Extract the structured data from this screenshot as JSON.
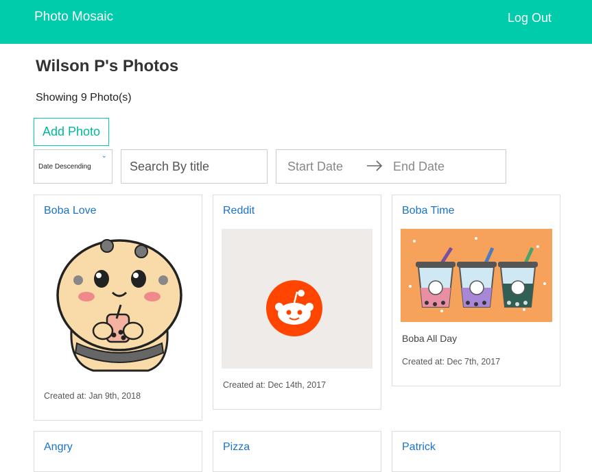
{
  "app": {
    "brand": "Photo Mosaic",
    "logout_label": "Log Out"
  },
  "page": {
    "title": "Wilson P's Photos",
    "count_text": "Showing 9 Photo(s)"
  },
  "toolbar": {
    "add_label": "Add Photo",
    "sort_value": "Date Descending",
    "search_placeholder": "Search By title",
    "start_date_placeholder": "Start Date",
    "end_date_placeholder": "End Date"
  },
  "photos": [
    {
      "title": "Boba Love",
      "description": "",
      "created": "Created at: Jan 9th, 2018"
    },
    {
      "title": "Reddit",
      "description": "",
      "created": "Created at: Dec 14th, 2017"
    },
    {
      "title": "Boba Time",
      "description": "Boba All Day",
      "created": "Created at: Dec 7th, 2017"
    },
    {
      "title": "Angry"
    },
    {
      "title": "Pizza"
    },
    {
      "title": "Patrick"
    }
  ],
  "colors": {
    "accent": "#00cbaa",
    "link": "#1a73c9",
    "reddit": "#ff4500",
    "boba_bg": "#f6a25a"
  }
}
